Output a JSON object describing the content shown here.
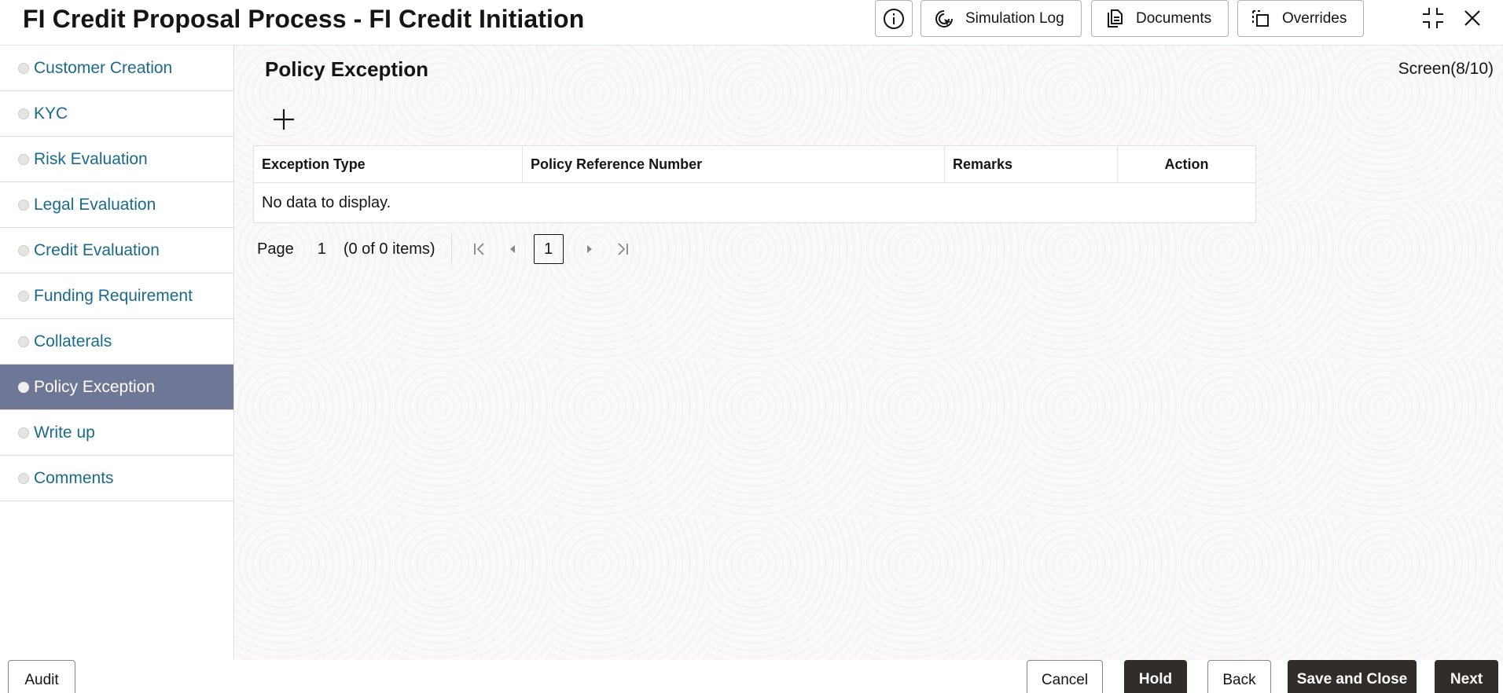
{
  "header": {
    "title": "FI Credit Proposal Process - FI Credit Initiation",
    "buttons": {
      "info_icon": "info-icon",
      "simulation_log": "Simulation Log",
      "documents": "Documents",
      "overrides": "Overrides"
    }
  },
  "sidebar": {
    "items": [
      {
        "label": "Customer Creation",
        "active": false
      },
      {
        "label": "KYC",
        "active": false
      },
      {
        "label": "Risk Evaluation",
        "active": false
      },
      {
        "label": "Legal Evaluation",
        "active": false
      },
      {
        "label": "Credit Evaluation",
        "active": false
      },
      {
        "label": "Funding Requirement",
        "active": false
      },
      {
        "label": "Collaterals",
        "active": false
      },
      {
        "label": "Policy Exception",
        "active": true
      },
      {
        "label": "Write up",
        "active": false
      },
      {
        "label": "Comments",
        "active": false
      }
    ]
  },
  "main": {
    "title": "Policy Exception",
    "screen_counter": "Screen(8/10)",
    "table": {
      "columns": [
        "Exception Type",
        "Policy Reference Number",
        "Remarks",
        "Action"
      ],
      "empty_text": "No data to display."
    },
    "pager": {
      "page_label": "Page",
      "page_value": "1",
      "items_text": "(0 of 0 items)",
      "current_page": "1"
    }
  },
  "footer": {
    "audit": "Audit",
    "cancel": "Cancel",
    "hold": "Hold",
    "back": "Back",
    "save_close": "Save and Close",
    "next": "Next"
  },
  "colors": {
    "active_item_bg": "#6e7795",
    "link_color": "#1a6a8c",
    "solid_button_bg": "#312d2a"
  }
}
